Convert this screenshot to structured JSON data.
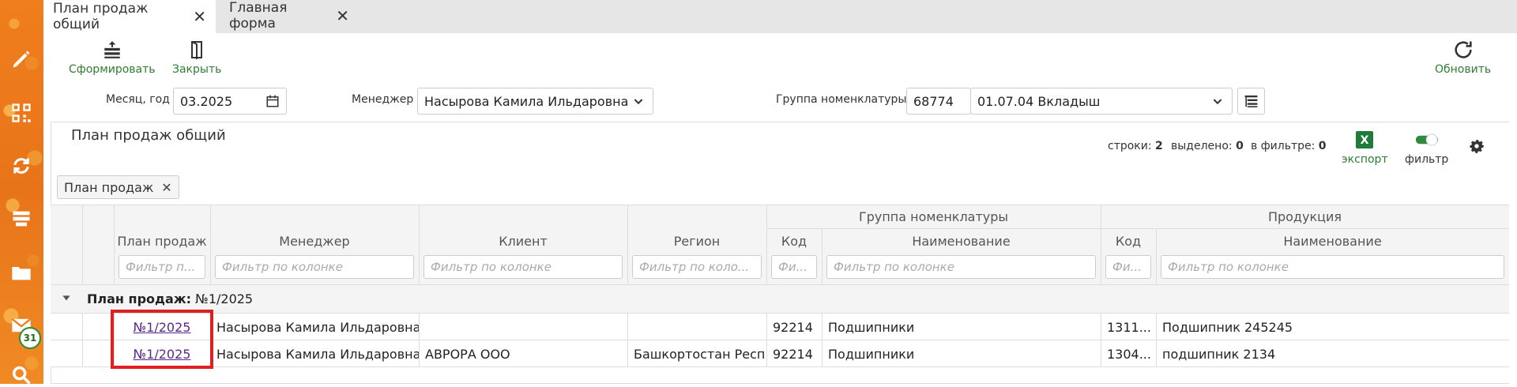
{
  "sidebar": {
    "icons": [
      "pencil-icon",
      "qr-code-icon",
      "sync-icon",
      "list-icon",
      "folder-icon",
      "mail-icon",
      "search-icon"
    ],
    "mail_badge": "31"
  },
  "tabs": [
    {
      "label": "План продаж общий",
      "active": true
    },
    {
      "label": "Главная форма",
      "active": false
    }
  ],
  "toolbar": {
    "generate_label": "Сформировать",
    "close_label": "Закрыть",
    "refresh_label": "Обновить"
  },
  "filters": {
    "month_label": "Месяц, год",
    "month_value": "03.2025",
    "manager_label": "Менеджер",
    "manager_value": "Насырова Камила Ильдаровна",
    "group_label": "Группа номенклатуры",
    "group_code": "68774",
    "group_name": "01.07.04 Вкладыш"
  },
  "panel": {
    "title": "План продаж общий",
    "rows_label": "строки:",
    "rows_value": "2",
    "selected_label": "выделено:",
    "selected_value": "0",
    "infilter_label": "в фильтре:",
    "infilter_value": "0",
    "export_label": "экспорт",
    "filter_label": "фильтр",
    "chip_label": "План продаж"
  },
  "grid": {
    "group_headers": {
      "nomenclature": "Группа номенклатуры",
      "product": "Продукция"
    },
    "columns": {
      "plan": "План продаж",
      "manager": "Менеджер",
      "client": "Клиент",
      "region": "Регион",
      "grp_code": "Код",
      "grp_name": "Наименование",
      "prod_code": "Код",
      "prod_name": "Наименование"
    },
    "filter_placeholders": {
      "plan": "Фильтр п...",
      "manager": "Фильтр по колонке",
      "client": "Фильтр по колонке",
      "region": "Фильтр по коло...",
      "grp_code": "Фи...",
      "grp_name": "Фильтр по колонке",
      "prod_code": "Фи...",
      "prod_name": "Фильтр по колонке"
    },
    "group_row": {
      "label": "План продаж:",
      "value": "№1/2025"
    },
    "rows": [
      {
        "plan": "№1/2025",
        "manager": "Насырова Камила Ильдаровна",
        "client": "",
        "region": "",
        "grp_code": "92214",
        "grp_name": "Подшипники",
        "prod_code": "1311...",
        "prod_name": "Подшипник 245245"
      },
      {
        "plan": "№1/2025",
        "manager": "Насырова Камила Ильдаровна",
        "client": "АВРОРА ООО",
        "region": "Башкортостан Респ",
        "grp_code": "92214",
        "grp_name": "Подшипники",
        "prod_code": "1304...",
        "prod_name": "подшипник 2134"
      }
    ]
  },
  "colors": {
    "accent_green": "#2e7d32",
    "sidebar_orange": "#f07e1c",
    "highlight_red": "#e02020",
    "link_purple": "#5a2a8a"
  }
}
